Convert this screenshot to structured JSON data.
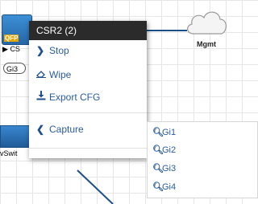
{
  "topology": {
    "router": {
      "badge": "QFP",
      "label": "CS",
      "interface_label": "Gi3"
    },
    "switch": {
      "label": "vSwit"
    },
    "cloud": {
      "label": "Mgmt"
    },
    "link_color": "#1a4e8a"
  },
  "context_menu": {
    "title": "CSR2 (2)",
    "items": [
      {
        "label": "Stop",
        "icon": "chevron-right-icon"
      },
      {
        "label": "Wipe",
        "icon": "eraser-icon"
      },
      {
        "label": "Export CFG",
        "icon": "download-icon"
      },
      {
        "label": "Capture",
        "icon": "chevron-left-icon"
      }
    ]
  },
  "capture_submenu": {
    "items": [
      {
        "label": "Gi1",
        "icon": "search-icon"
      },
      {
        "label": "Gi2",
        "icon": "search-icon"
      },
      {
        "label": "Gi3",
        "icon": "search-icon"
      },
      {
        "label": "Gi4",
        "icon": "search-icon"
      }
    ]
  }
}
